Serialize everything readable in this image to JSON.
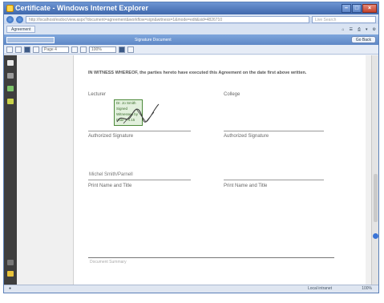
{
  "window": {
    "title": "Certificate - Windows Internet Explorer"
  },
  "address": {
    "url": "http://localhost/esdoc/view.aspx?document=agreement&workflow=sign&witness=1&mode=edit&sid=4826710",
    "search_placeholder": "Live Search"
  },
  "tabs": {
    "active_tab": "Agreement"
  },
  "document_bar": {
    "document_name": "Signature Document",
    "sign_button": "Go Back"
  },
  "toolbar": {
    "zoom": "100%",
    "page_field": "Page 4"
  },
  "document": {
    "witness_clause": "IN WITNESS WHEREOF, the parties hereto have executed this Agreement on the date first above written.",
    "left_column": {
      "heading": "Lecturer",
      "stamp_lines": [
        "Dr. Jo Smith",
        "Signed",
        "Witnessed by",
        "Date 7.4.15"
      ],
      "signature_label": "Authorized Signature",
      "printed_name": "Michel Smith/Parnell",
      "name_title_label": "Print Name and Title"
    },
    "right_column": {
      "heading": "College",
      "signature_label": "Authorized Signature",
      "name_title_label": "Print Name and Title"
    },
    "footer_text": "Document Summary"
  },
  "status": {
    "zone": "Local intranet",
    "zoom": "100%"
  },
  "colors": {
    "titlebar": "#3f68ac",
    "docbar": "#5e87c6",
    "leftpanel": "#3e3e3e",
    "stamp_green": "#4c8a3a"
  }
}
